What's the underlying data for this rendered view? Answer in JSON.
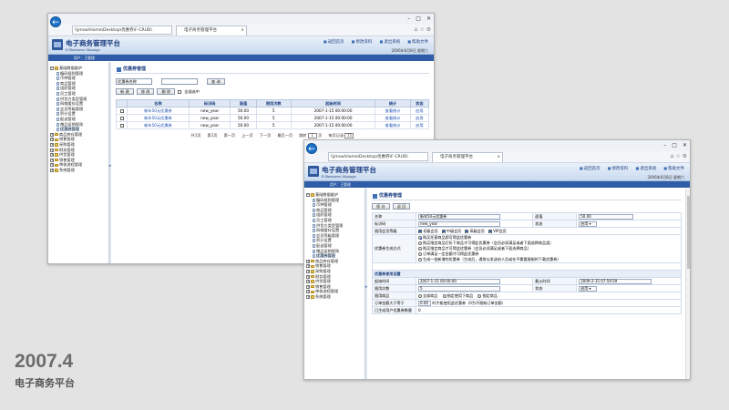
{
  "caption": {
    "year": "2007.4",
    "name": "电子商务平台"
  },
  "browser": {
    "address": "\\\\jmsw\\Home\\Desktop\\优惠券\\F-CRUD\\",
    "tab_title": "电子商务管理平台",
    "address2": "\\\\jmsw\\Home\\Desktop\\优惠券\\F-CRUD\\"
  },
  "app": {
    "title": "电子商务管理平台",
    "subtitle": "E-Business Manage",
    "links": [
      "返回首页",
      "修改资料",
      "退出系统",
      "帮助文件"
    ],
    "date": "2006年6月8日 星期六",
    "userbar": "用户：王管理"
  },
  "sidebar": [
    {
      "label": "基础数据维护",
      "type": "root",
      "children": [
        "编码规则管理",
        "币种管理",
        "商品管理",
        "组织管理",
        "员工管理",
        "供货方类型管理",
        "网络缓存设置",
        "会员等级管理",
        "积分设置",
        "配送管理",
        "赠品促销规则",
        "优惠券管理"
      ]
    },
    {
      "label": "商品库存管理",
      "type": "root",
      "children": []
    },
    {
      "label": "销售管理",
      "type": "root",
      "children": []
    },
    {
      "label": "采购管理",
      "type": "root",
      "children": []
    },
    {
      "label": "财务管理",
      "type": "root",
      "children": []
    },
    {
      "label": "供货管理",
      "type": "root",
      "children": []
    },
    {
      "label": "销售管理",
      "type": "root",
      "children": []
    },
    {
      "label": "审核流程管理",
      "type": "root",
      "children": []
    },
    {
      "label": "系统管理",
      "type": "root",
      "children": []
    }
  ],
  "list_page": {
    "title": "优惠券管理",
    "filter_select": "优惠券名称",
    "search_label": "查 询",
    "buttons": [
      "新 建",
      "修 改",
      "删 除"
    ],
    "select_all": "全部选中",
    "columns": [
      "名称",
      "标识码",
      "面值",
      "限用次数",
      "起始时间",
      "统计",
      "状态"
    ],
    "rows": [
      {
        "name": "新年50元优惠券",
        "code": "new_year",
        "value": "50.00",
        "limit": "5",
        "start": "2007-1-15 00:00:00",
        "stat": "查看统计",
        "status": "启用"
      },
      {
        "name": "新年50元优惠券",
        "code": "new_year",
        "value": "50.00",
        "limit": "5",
        "start": "2007-1-15 00:00:00",
        "stat": "查看统计",
        "status": "启用"
      },
      {
        "name": "新年50元优惠券",
        "code": "new_year",
        "value": "50.00",
        "limit": "5",
        "start": "2007-1-15 00:00:00",
        "stat": "查看统计",
        "status": "启用"
      }
    ],
    "pager": {
      "total": "共1页",
      "first": "第1页",
      "home": "第一页",
      "prev": "上一页",
      "next": "下一页",
      "last": "最后一页",
      "jump_label": "跳转",
      "page_value": "1",
      "page_suffix": "页",
      "per_page_label": "每页记录",
      "per_page": "15"
    }
  },
  "form_page": {
    "title": "优惠券管理",
    "buttons": [
      "保 存",
      "返 回"
    ],
    "fields": {
      "name_label": "名称",
      "name_value": "新年50元优惠券",
      "value_label": "面值",
      "value_value": "50.00",
      "code_label": "标识码",
      "code_value": "new_year",
      "status_label": "状态",
      "status_value": "启用",
      "member_label": "限用会员等级",
      "member_opts": [
        "初级会员",
        "中级会员",
        "高级会员",
        "VIP会员"
      ],
      "mode_label": "优惠券生成方式",
      "mode_opts": [
        "购买任意商品即可得此优惠券",
        "购买指定商品打折下商品才可得此优惠券（会员必须满足或者下面选择商品类）",
        "购买指定商品才可得此优惠券（会员必须满足或者下面选择商品）",
        "订单满足一定金额才可得此优惠券",
        "生成一批新增的优惠券（生成后，通常以发送给人员或在不需要限制时下载优惠券）"
      ],
      "section_label": "优惠券使用设置",
      "start_label": "起始时间",
      "start_value": "2007-1-15 00:00:00",
      "end_label": "截止时间",
      "end_value": "2009-2-15 07:59:59",
      "limit_label": "限用次数",
      "limit_value": "5",
      "status2_label": "状态",
      "status2_value": "启用",
      "goods_label": "限用商品",
      "goods_opts": [
        "全部商品",
        "指定使用下商品",
        "指定商品"
      ],
      "min_label": "订单金额大于等于",
      "min_value": "0.00",
      "min_note": "时才能使用此优惠券（0为不限制订单金额）",
      "used_label": "已生成用户优惠券数量",
      "used_value": "0"
    }
  }
}
